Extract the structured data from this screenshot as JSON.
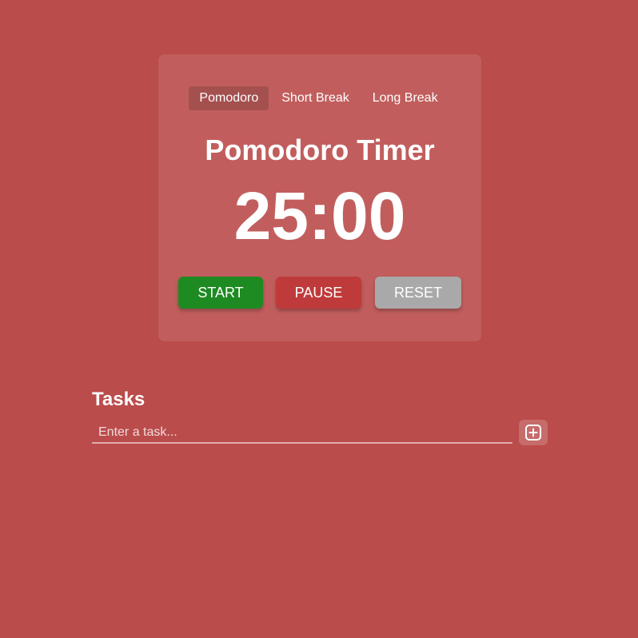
{
  "tabs": [
    {
      "label": "Pomodoro",
      "active": true
    },
    {
      "label": "Short Break",
      "active": false
    },
    {
      "label": "Long Break",
      "active": false
    }
  ],
  "title": "Pomodoro Timer",
  "timer": "25:00",
  "controls": {
    "start_label": "START",
    "pause_label": "PAUSE",
    "reset_label": "RESET"
  },
  "tasks": {
    "heading": "Tasks",
    "input_value": "",
    "input_placeholder": "Enter a task...",
    "add_icon": "plus-square-icon"
  },
  "colors": {
    "background": "#ba4c4b",
    "start": "#1e8a22",
    "pause": "#bf3a3a",
    "reset": "#a9a9a9"
  }
}
